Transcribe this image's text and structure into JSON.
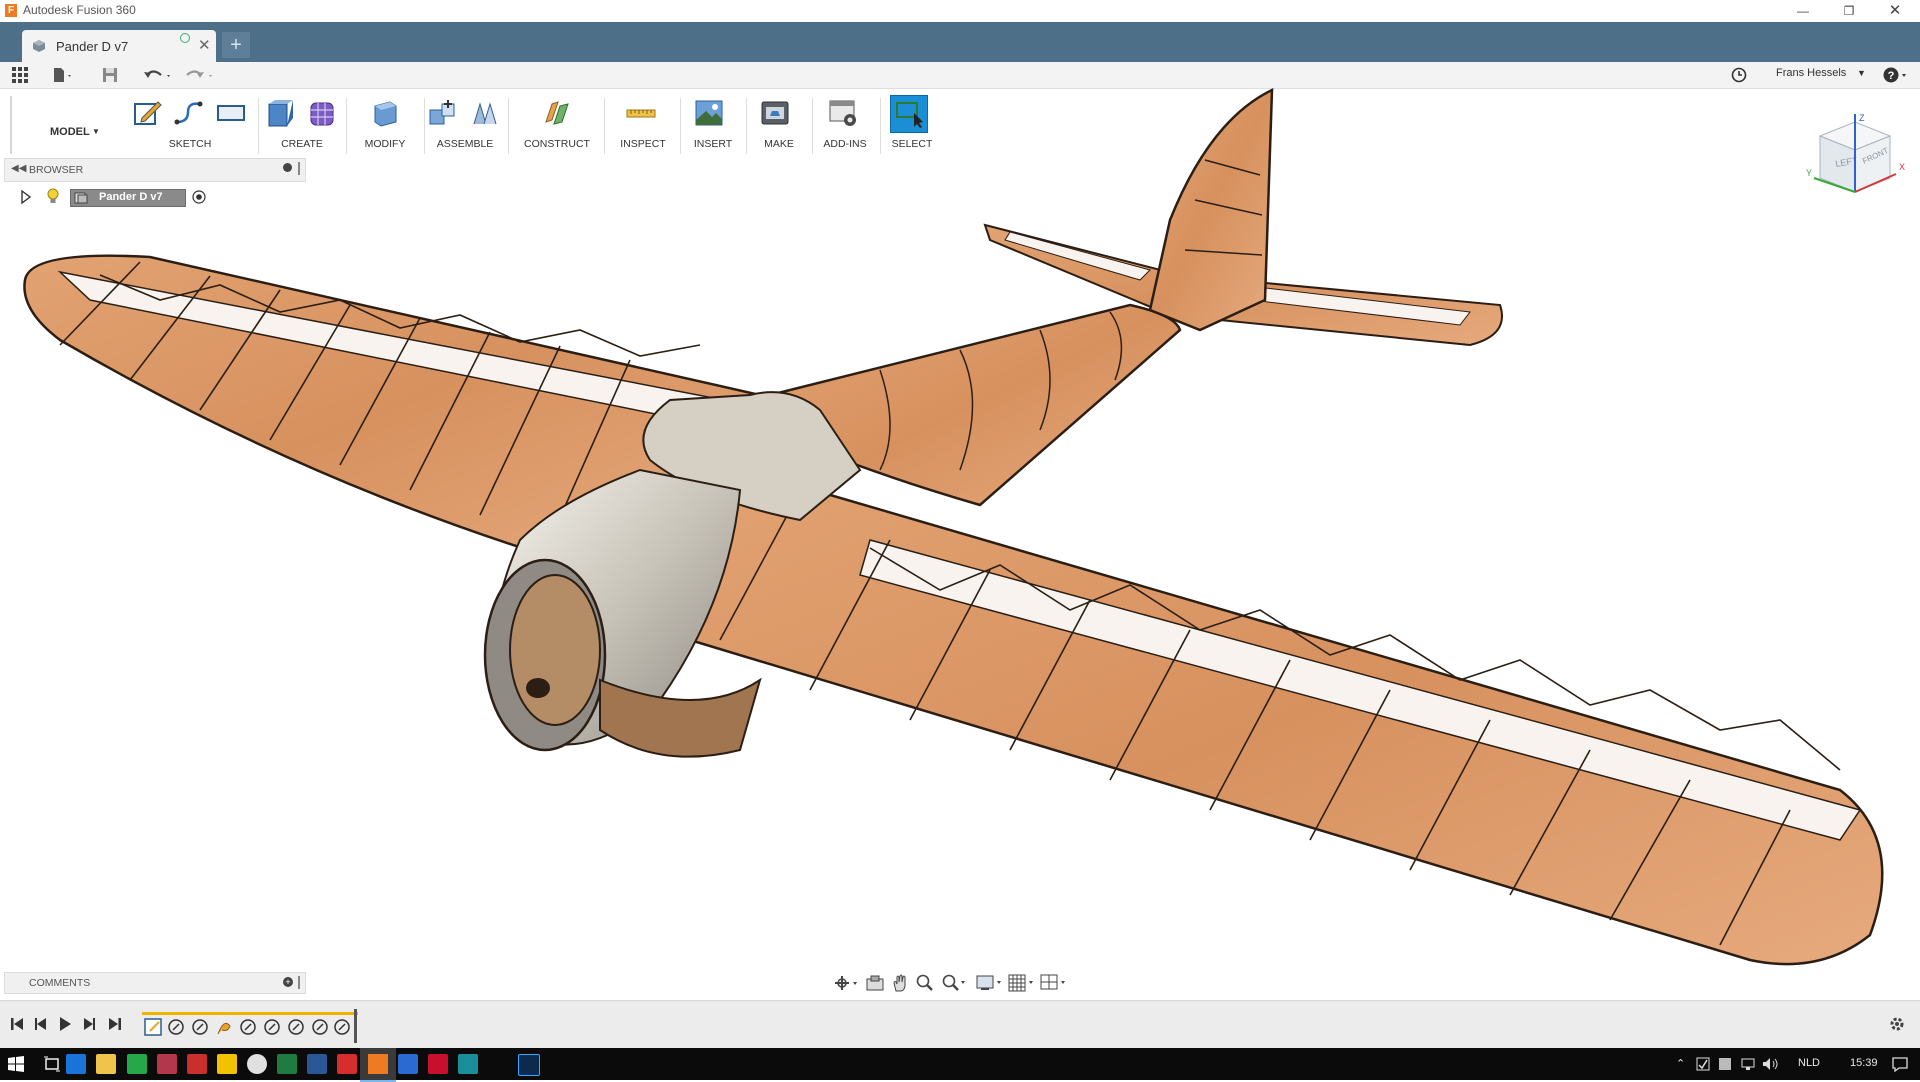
{
  "window": {
    "title": "Autodesk Fusion 360",
    "app_icon_letter": "F"
  },
  "tab": {
    "label": "Pander D v7",
    "new_tab_symbol": "+"
  },
  "user": {
    "name": "Frans Hessels"
  },
  "toolbar": {
    "workspace": "MODEL",
    "groups": [
      {
        "label": "SKETCH"
      },
      {
        "label": "CREATE"
      },
      {
        "label": "MODIFY"
      },
      {
        "label": "ASSEMBLE"
      },
      {
        "label": "CONSTRUCT"
      },
      {
        "label": "INSPECT"
      },
      {
        "label": "INSERT"
      },
      {
        "label": "MAKE"
      },
      {
        "label": "ADD-INS"
      },
      {
        "label": "SELECT"
      }
    ]
  },
  "browser": {
    "label": "BROWSER",
    "root_node": "Pander D v7"
  },
  "comments": {
    "label": "COMMENTS"
  },
  "viewcube": {
    "left": "LEFT",
    "front": "FRONT",
    "z": "Z",
    "x": "X",
    "y": "Y"
  },
  "taskbar": {
    "language": "NLD",
    "time": "15:39"
  },
  "colors": {
    "tabbar": "#4e6f88",
    "select_active": "#1a8fd6",
    "wood": "#d9956a",
    "taskbar": "#0b0b0b"
  }
}
